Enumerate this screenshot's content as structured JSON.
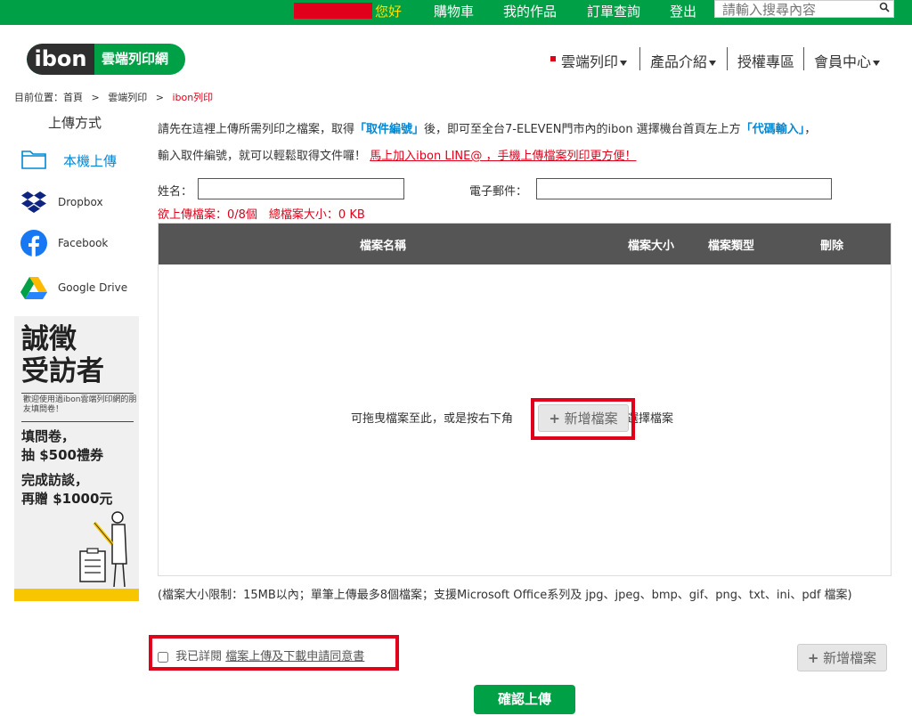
{
  "topbar": {
    "greeting": "您好",
    "links": [
      "購物車",
      "我的作品",
      "訂單查詢",
      "登出"
    ],
    "search_placeholder": "請輸入搜尋內容"
  },
  "logo": {
    "brand": "ibon",
    "site": "雲端列印網"
  },
  "nav": {
    "items": [
      "雲端列印",
      "產品介紹",
      "授權專區",
      "會員中心"
    ]
  },
  "breadcrumb": {
    "prefix": "目前位置：首頁",
    "sep": ">",
    "level2": "雲端列印",
    "current": "ibon列印"
  },
  "sidebar": {
    "title": "上傳方式",
    "items": [
      {
        "label": "本機上傳",
        "icon": "folder-icon"
      },
      {
        "label": "Dropbox",
        "icon": "dropbox-icon"
      },
      {
        "label": "Facebook",
        "icon": "facebook-icon"
      },
      {
        "label": "Google Drive",
        "icon": "google-drive-icon"
      }
    ]
  },
  "ad": {
    "line1": "誠徵",
    "line2": "受訪者",
    "small": "歡迎使用過ibon雲端列印網的朋友填問卷！",
    "mid1": "填問卷，",
    "mid2": "抽 $500禮券",
    "mid3": "完成訪談，",
    "mid4": "再贈 $1000元"
  },
  "intro": {
    "p1a": "請先在這裡上傳所需列印之檔案，取得",
    "p1b": "「取件編號」",
    "p1c": "後，即可至全台7-ELEVEN門市內的ibon 選擇機台首頁左上方",
    "p1d": "「代碼輸入」",
    "p1e": "，",
    "p2a": "輸入取件編號，就可以輕鬆取得文件囉！",
    "p2link": "馬上加入ibon LINE@ ，手機上傳檔案列印更方便！"
  },
  "form": {
    "name_label": "姓名：",
    "email_label": "電子郵件：",
    "count_info": "欲上傳檔案：0/8個　總檔案大小：0 KB"
  },
  "table": {
    "headers": [
      "檔案名稱",
      "檔案大小",
      "檔案類型",
      "刪除"
    ],
    "drop_text_before": "可拖曳檔案至此，或是按右下角",
    "drop_text_after": "來選擇檔案"
  },
  "add_button": {
    "plus": "+",
    "label": "新增檔案"
  },
  "limit_note": "(檔案大小限制：15MB以內；單筆上傳最多8個檔案；支援Microsoft Office系列及 jpg、jpeg、bmp、gif、png、txt、ini、pdf 檔案)",
  "agree": {
    "prefix": "我已詳閱",
    "link": "檔案上傳及下載申請同意書"
  },
  "confirm_label": "確認上傳",
  "colors": {
    "brand_green": "#00a046",
    "alert_red": "#e0001b",
    "link_blue": "#0088d5",
    "header_gray": "#555555"
  }
}
